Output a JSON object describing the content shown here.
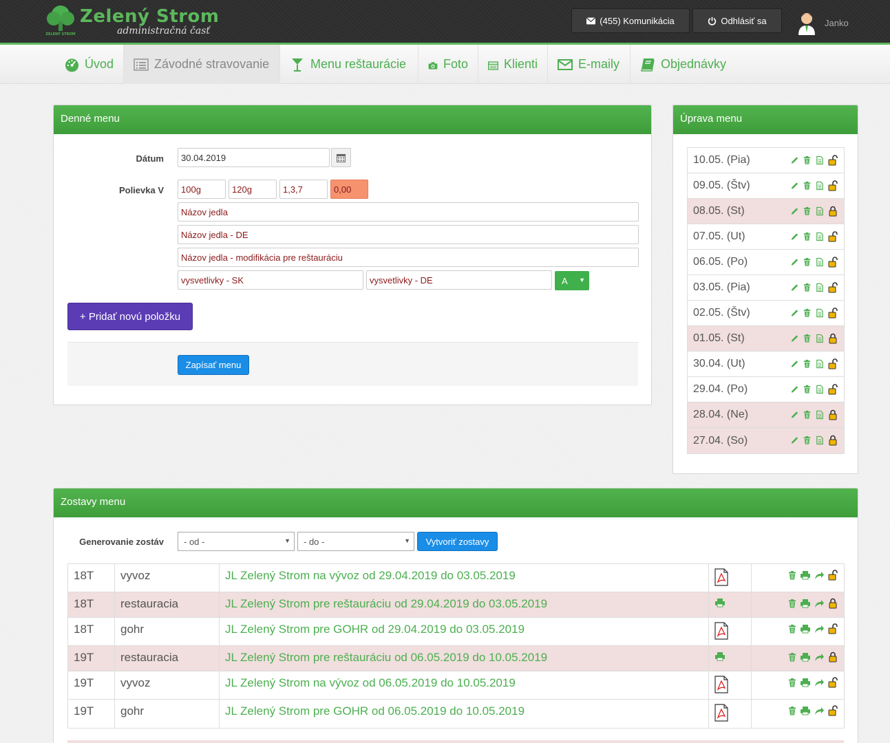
{
  "header": {
    "logo_title": "Zelený Strom",
    "logo_subtitle": "administračná časť",
    "logo_small_text": "ZELENÝ STROM",
    "messages_button": "(455) Komunikácia",
    "logout_button": "Odhlásiť sa",
    "username": "Janko"
  },
  "nav": {
    "items": [
      {
        "label": "Úvod",
        "icon": "dashboard-icon"
      },
      {
        "label": "Závodné stravovanie",
        "icon": "list-icon"
      },
      {
        "label": "Menu reštaurácie",
        "icon": "cocktail-glass-icon"
      },
      {
        "label": "Foto",
        "icon": "camera-icon"
      },
      {
        "label": "Klienti",
        "icon": "table-list-icon"
      },
      {
        "label": "E-maily",
        "icon": "envelope-icon"
      },
      {
        "label": "Objednávky",
        "icon": "book-icon"
      }
    ],
    "active_index": 1
  },
  "daily_menu": {
    "title": "Denné menu",
    "date_label": "Dátum",
    "date_value": "30.04.2019",
    "soup_label": "Polievka V",
    "amount1": "100g",
    "amount2": "120g",
    "allergens": "1,3,7",
    "price": "0,00",
    "name_placeholder": "Názov jedla",
    "name_de_placeholder": "Názov jedla - DE",
    "name_mod_placeholder": "Názov jedla - modifikácia pre reštauráciu",
    "notes_sk_placeholder": "vysvetlivky - SK",
    "notes_de_placeholder": "vysvetlivky - DE",
    "variant_value": "A",
    "add_item_button": "+ Pridať novú položku",
    "save_button": "Zapísať menu"
  },
  "edit_menu": {
    "title": "Úprava menu",
    "items": [
      {
        "label": "10.05. (Pia)",
        "locked": false
      },
      {
        "label": "09.05. (Štv)",
        "locked": false
      },
      {
        "label": "08.05. (St)",
        "locked": true
      },
      {
        "label": "07.05. (Ut)",
        "locked": false
      },
      {
        "label": "06.05. (Po)",
        "locked": false
      },
      {
        "label": "03.05. (Pia)",
        "locked": false
      },
      {
        "label": "02.05. (Štv)",
        "locked": false
      },
      {
        "label": "01.05. (St)",
        "locked": true
      },
      {
        "label": "30.04. (Ut)",
        "locked": false
      },
      {
        "label": "29.04. (Po)",
        "locked": false
      },
      {
        "label": "28.04. (Ne)",
        "locked": true
      },
      {
        "label": "27.04. (So)",
        "locked": true
      }
    ]
  },
  "reports": {
    "title": "Zostavy menu",
    "generate_label": "Generovanie zostáv",
    "from_select": "- od -",
    "to_select": "- do -",
    "create_button": "Vytvoriť zostavy",
    "rows": [
      {
        "week": "18T",
        "type": "vyvoz",
        "title": "JL Zelený Strom na vývoz od 29.04.2019 do 03.05.2019",
        "file": "pdf",
        "locked": false
      },
      {
        "week": "18T",
        "type": "restauracia",
        "title": "JL Zelený Strom pre reštauráciu od 29.04.2019 do 03.05.2019",
        "file": "print",
        "locked": true
      },
      {
        "week": "18T",
        "type": "gohr",
        "title": "JL Zelený Strom pre GOHR od 29.04.2019 do 03.05.2019",
        "file": "pdf",
        "locked": false
      },
      {
        "week": "19T",
        "type": "restauracia",
        "title": "JL Zelený Strom pre reštauráciu od 06.05.2019 do 10.05.2019",
        "file": "print",
        "locked": true
      },
      {
        "week": "19T",
        "type": "vyvoz",
        "title": "JL Zelený Strom na vývoz od 06.05.2019 do 10.05.2019",
        "file": "pdf",
        "locked": false
      },
      {
        "week": "19T",
        "type": "gohr",
        "title": "JL Zelený Strom pre GOHR od 06.05.2019 do 10.05.2019",
        "file": "pdf",
        "locked": false
      }
    ]
  },
  "colors": {
    "brand_green": "#4caf50",
    "panel_header": "#46a642",
    "locked_row": "#f1dede",
    "primary_blue": "#1a8de6",
    "purple": "#5b3cb4"
  }
}
